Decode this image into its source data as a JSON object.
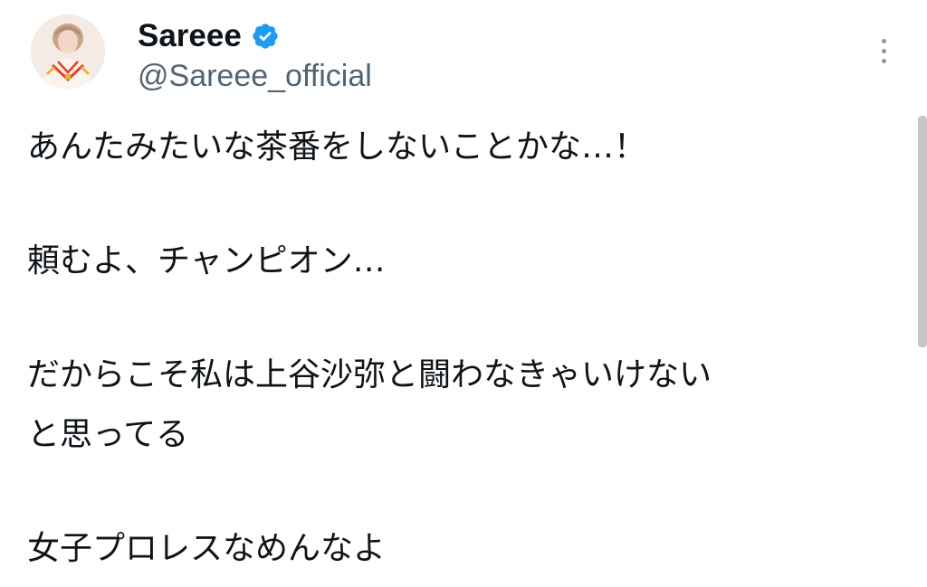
{
  "profile": {
    "display_name": "Sareee",
    "handle": "@Sareee_official",
    "verified_color": "#1d9bf0",
    "avatar_icon": "profile-avatar"
  },
  "menu": {
    "icon": "more-vertical-icon"
  },
  "tweet": {
    "paragraphs": [
      {
        "lines": [
          "あんたみたいな茶番をしないことかな…！"
        ]
      },
      {
        "lines": [
          "頼むよ、チャンピオン…"
        ]
      },
      {
        "lines": [
          "だからこそ私は上谷沙弥と闘わなきゃいけない",
          "と思ってる"
        ]
      },
      {
        "lines": [
          "女子プロレスなめんなよ"
        ]
      }
    ]
  }
}
